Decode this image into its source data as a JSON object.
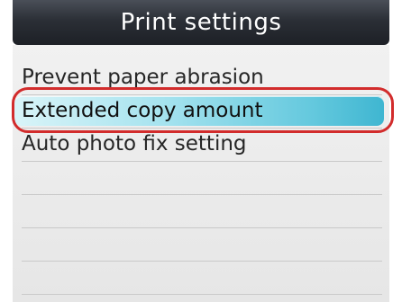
{
  "screen": {
    "title": "Print settings"
  },
  "menu": {
    "items": [
      {
        "label": "Prevent paper abrasion"
      },
      {
        "label": "Extended copy amount",
        "selected": true
      },
      {
        "label": "Auto photo fix setting"
      }
    ]
  },
  "colors": {
    "title_bar": "#1d2026",
    "selection": "#3fb6d1",
    "annotation_ring": "#d22c2c"
  }
}
